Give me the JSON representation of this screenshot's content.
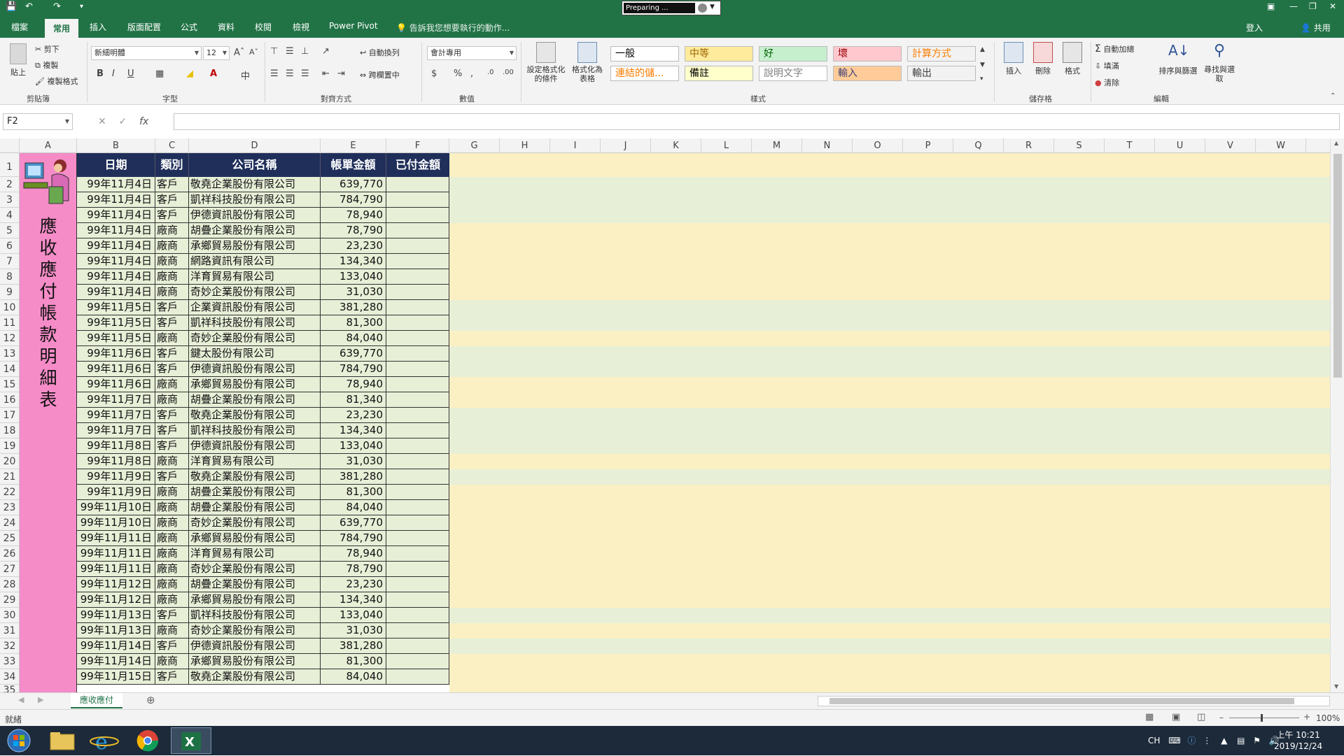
{
  "titlebar": {
    "preparing": "Preparing ..."
  },
  "menu": {
    "tabs": [
      "檔案",
      "常用",
      "插入",
      "版面配置",
      "公式",
      "資料",
      "校閱",
      "檢視",
      "Power Pivot"
    ],
    "active_tab": "常用",
    "tell_me": "告訴我您想要執行的動作...",
    "sign_in": "登入",
    "share": "共用"
  },
  "ribbon": {
    "clipboard": {
      "paste": "貼上",
      "cut": "剪下",
      "copy": "複製",
      "format_painter": "複製格式",
      "label": "剪貼簿"
    },
    "font": {
      "name": "新細明體",
      "size": "12",
      "label": "字型",
      "bold": "B",
      "italic": "I",
      "underline": "U"
    },
    "alignment": {
      "wrap": "自動換列",
      "merge": "跨欄置中",
      "label": "對齊方式"
    },
    "number": {
      "format": "會計專用",
      "label": "數值"
    },
    "styles": {
      "conditional": "設定格式化的條件",
      "as_table": "格式化為表格",
      "cells": [
        {
          "text": "一般",
          "bg": "#ffffff",
          "fg": "#000000"
        },
        {
          "text": "中等",
          "bg": "#ffeb9c",
          "fg": "#9c6500"
        },
        {
          "text": "好",
          "bg": "#c6efce",
          "fg": "#006100"
        },
        {
          "text": "壞",
          "bg": "#ffc7ce",
          "fg": "#9c0006"
        },
        {
          "text": "計算方式",
          "bg": "#f2f2f2",
          "fg": "#fa7d00"
        },
        {
          "text": "連結的儲...",
          "bg": "#ffffff",
          "fg": "#fa7d00"
        },
        {
          "text": "備註",
          "bg": "#ffffcc",
          "fg": "#000000"
        },
        {
          "text": "說明文字",
          "bg": "#ffffff",
          "fg": "#7f7f7f"
        },
        {
          "text": "輸入",
          "bg": "#ffcc99",
          "fg": "#3f3f76"
        },
        {
          "text": "輸出",
          "bg": "#f2f2f2",
          "fg": "#3f3f3f"
        }
      ],
      "label": "樣式"
    },
    "cells_group": {
      "insert": "插入",
      "delete": "刪除",
      "format": "格式",
      "label": "儲存格"
    },
    "editing": {
      "autosum": "自動加總",
      "fill": "填滿",
      "clear": "清除",
      "sort": "排序與篩選",
      "find": "尋找與選取",
      "label": "編輯"
    }
  },
  "formula_bar": {
    "name_box": "F2",
    "fx": "fx",
    "content": ""
  },
  "columns": [
    "A",
    "B",
    "C",
    "D",
    "E",
    "F",
    "G",
    "H",
    "I",
    "J",
    "K",
    "L",
    "M",
    "N",
    "O",
    "P",
    "Q",
    "R",
    "S",
    "T",
    "U",
    "V",
    "W"
  ],
  "sheet": {
    "title_vertical": "應收應付帳款明細表",
    "header": [
      "日期",
      "類別",
      "公司名稱",
      "帳單金額",
      "已付金額"
    ],
    "rows": [
      [
        "99年11月4日",
        "客戶",
        "敬堯企業股份有限公司",
        "639,770",
        ""
      ],
      [
        "99年11月4日",
        "客戶",
        "凱祥科技股份有限公司",
        "784,790",
        ""
      ],
      [
        "99年11月4日",
        "客戶",
        "伊德資訊股份有限公司",
        "78,940",
        ""
      ],
      [
        "99年11月4日",
        "廠商",
        "胡疊企業股份有限公司",
        "78,790",
        ""
      ],
      [
        "99年11月4日",
        "廠商",
        "承鄉貿易股份有限公司",
        "23,230",
        ""
      ],
      [
        "99年11月4日",
        "廠商",
        "網路資訊有限公司",
        "134,340",
        ""
      ],
      [
        "99年11月4日",
        "廠商",
        "洋育貿易有限公司",
        "133,040",
        ""
      ],
      [
        "99年11月4日",
        "廠商",
        "奇妙企業股份有限公司",
        "31,030",
        ""
      ],
      [
        "99年11月5日",
        "客戶",
        "企業資訊股份有限公司",
        "381,280",
        ""
      ],
      [
        "99年11月5日",
        "客戶",
        "凱祥科技股份有限公司",
        "81,300",
        ""
      ],
      [
        "99年11月5日",
        "廠商",
        "奇妙企業股份有限公司",
        "84,040",
        ""
      ],
      [
        "99年11月6日",
        "客戶",
        "鍵太股份有限公司",
        "639,770",
        ""
      ],
      [
        "99年11月6日",
        "客戶",
        "伊德資訊股份有限公司",
        "784,790",
        ""
      ],
      [
        "99年11月6日",
        "廠商",
        "承鄉貿易股份有限公司",
        "78,940",
        ""
      ],
      [
        "99年11月7日",
        "廠商",
        "胡疊企業股份有限公司",
        "81,340",
        ""
      ],
      [
        "99年11月7日",
        "客戶",
        "敬堯企業股份有限公司",
        "23,230",
        ""
      ],
      [
        "99年11月7日",
        "客戶",
        "凱祥科技股份有限公司",
        "134,340",
        ""
      ],
      [
        "99年11月8日",
        "客戶",
        "伊德資訊股份有限公司",
        "133,040",
        ""
      ],
      [
        "99年11月8日",
        "廠商",
        "洋育貿易有限公司",
        "31,030",
        ""
      ],
      [
        "99年11月9日",
        "客戶",
        "敬堯企業股份有限公司",
        "381,280",
        ""
      ],
      [
        "99年11月9日",
        "廠商",
        "胡疊企業股份有限公司",
        "81,300",
        ""
      ],
      [
        "99年11月10日",
        "廠商",
        "胡疊企業股份有限公司",
        "84,040",
        ""
      ],
      [
        "99年11月10日",
        "廠商",
        "奇妙企業股份有限公司",
        "639,770",
        ""
      ],
      [
        "99年11月11日",
        "廠商",
        "承鄉貿易股份有限公司",
        "784,790",
        ""
      ],
      [
        "99年11月11日",
        "廠商",
        "洋育貿易有限公司",
        "78,940",
        ""
      ],
      [
        "99年11月11日",
        "廠商",
        "奇妙企業股份有限公司",
        "78,790",
        ""
      ],
      [
        "99年11月12日",
        "廠商",
        "胡疊企業股份有限公司",
        "23,230",
        ""
      ],
      [
        "99年11月12日",
        "廠商",
        "承鄉貿易股份有限公司",
        "134,340",
        ""
      ],
      [
        "99年11月13日",
        "客戶",
        "凱祥科技股份有限公司",
        "133,040",
        ""
      ],
      [
        "99年11月13日",
        "廠商",
        "奇妙企業股份有限公司",
        "31,030",
        ""
      ],
      [
        "99年11月14日",
        "客戶",
        "伊德資訊股份有限公司",
        "381,280",
        ""
      ],
      [
        "99年11月14日",
        "廠商",
        "承鄉貿易股份有限公司",
        "81,300",
        ""
      ],
      [
        "99年11月15日",
        "客戶",
        "敬堯企業股份有限公司",
        "84,040",
        ""
      ]
    ]
  },
  "sheet_tab": "應收應付",
  "status": {
    "ready": "就緒",
    "zoom": "100%"
  },
  "taskbar": {
    "ime": "CH",
    "time": "上午 10:21",
    "date": "2019/12/24"
  }
}
